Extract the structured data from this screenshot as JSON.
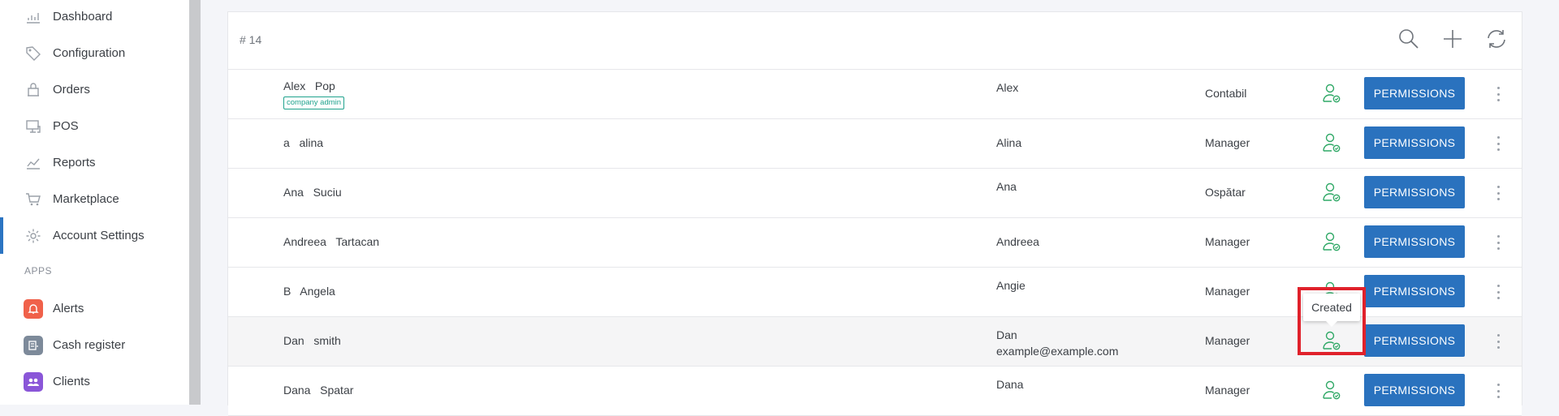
{
  "sidebar": {
    "items": [
      {
        "label": "Dashboard",
        "icon": "dashboard-icon"
      },
      {
        "label": "Configuration",
        "icon": "tag-icon"
      },
      {
        "label": "Orders",
        "icon": "orders-icon"
      },
      {
        "label": "POS",
        "icon": "pos-icon"
      },
      {
        "label": "Reports",
        "icon": "reports-icon"
      },
      {
        "label": "Marketplace",
        "icon": "cart-icon"
      },
      {
        "label": "Account Settings",
        "icon": "gear-icon",
        "active": true
      }
    ],
    "apps_label": "APPS",
    "apps": [
      {
        "label": "Alerts",
        "icon": "bell-icon",
        "color": "#f0614a"
      },
      {
        "label": "Cash register",
        "icon": "cash-register-icon",
        "color": "#7d8a9a"
      },
      {
        "label": "Clients",
        "icon": "clients-icon",
        "color": "#8a56d8"
      }
    ]
  },
  "header": {
    "count": "# 14"
  },
  "toolbar": {
    "search_icon": "search-icon",
    "add_icon": "plus-icon",
    "refresh_icon": "refresh-icon"
  },
  "users": [
    {
      "first": "Alex",
      "last": "Pop",
      "badge": "company admin",
      "nickname": "Alex",
      "role": "Contabil"
    },
    {
      "first": "a",
      "last": "alina",
      "nickname": "Alina",
      "role": "Manager"
    },
    {
      "first": "Ana",
      "last": "Suciu",
      "nickname": "Ana",
      "role": "Ospătar"
    },
    {
      "first": "Andreea",
      "last": "Tartacan",
      "nickname": "Andreea",
      "role": "Manager"
    },
    {
      "first": "B",
      "last": "Angela",
      "nickname": "Angie",
      "role": "Manager"
    },
    {
      "first": "Dan",
      "last": "smith",
      "nickname": "Dan",
      "email": "example@example.com",
      "role": "Manager",
      "highlight": true
    },
    {
      "first": "Dana",
      "last": "Spatar",
      "nickname": "Dana",
      "role": "Manager"
    }
  ],
  "row_button_label": "PERMISSIONS",
  "tooltip": {
    "text": "Created"
  },
  "colors": {
    "accent": "#2a72be",
    "status_green": "#2fa866",
    "badge_teal": "#1fa28d",
    "annotation_red": "#e0212b"
  }
}
